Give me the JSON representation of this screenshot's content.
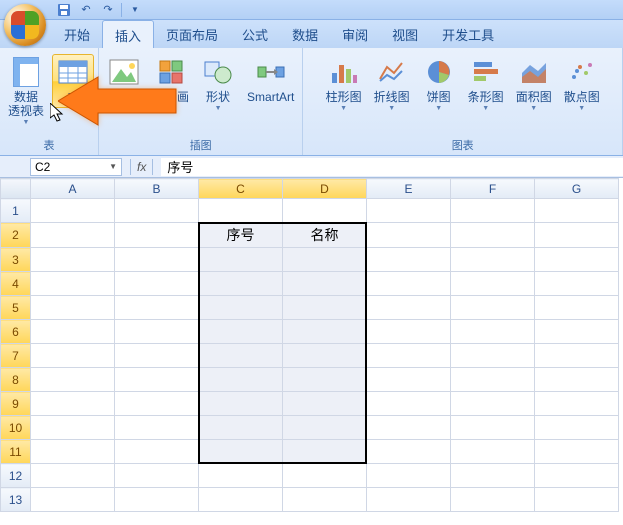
{
  "qat": {
    "save": "💾",
    "undo": "↶",
    "redo": "↷"
  },
  "tabs": {
    "home": "开始",
    "insert": "插入",
    "layout": "页面布局",
    "formulas": "公式",
    "data": "数据",
    "review": "审阅",
    "view": "视图",
    "dev": "开发工具"
  },
  "ribbon": {
    "groups": {
      "tables": {
        "label": "表",
        "pivot": "数据\n透视表",
        "table": "表"
      },
      "illustrations": {
        "label": "插图",
        "picture": "图片",
        "clipart": "剪贴画",
        "shapes": "形状",
        "smartart": "SmartArt"
      },
      "charts": {
        "label": "图表",
        "column": "柱形图",
        "line": "折线图",
        "pie": "饼图",
        "bar": "条形图",
        "area": "面积图",
        "scatter": "散点图"
      }
    }
  },
  "formula_bar": {
    "name_box": "C2",
    "fx": "fx",
    "value": "序号"
  },
  "grid": {
    "columns": [
      "A",
      "B",
      "C",
      "D",
      "E",
      "F",
      "G"
    ],
    "rows": [
      "1",
      "2",
      "3",
      "4",
      "5",
      "6",
      "7",
      "8",
      "9",
      "10",
      "11",
      "12",
      "13"
    ],
    "cells": {
      "C2": "序号",
      "D2": "名称"
    },
    "selected_cols": [
      "C",
      "D"
    ],
    "selected_rows": [
      "2",
      "3",
      "4",
      "5",
      "6",
      "7",
      "8",
      "9",
      "10",
      "11"
    ]
  }
}
